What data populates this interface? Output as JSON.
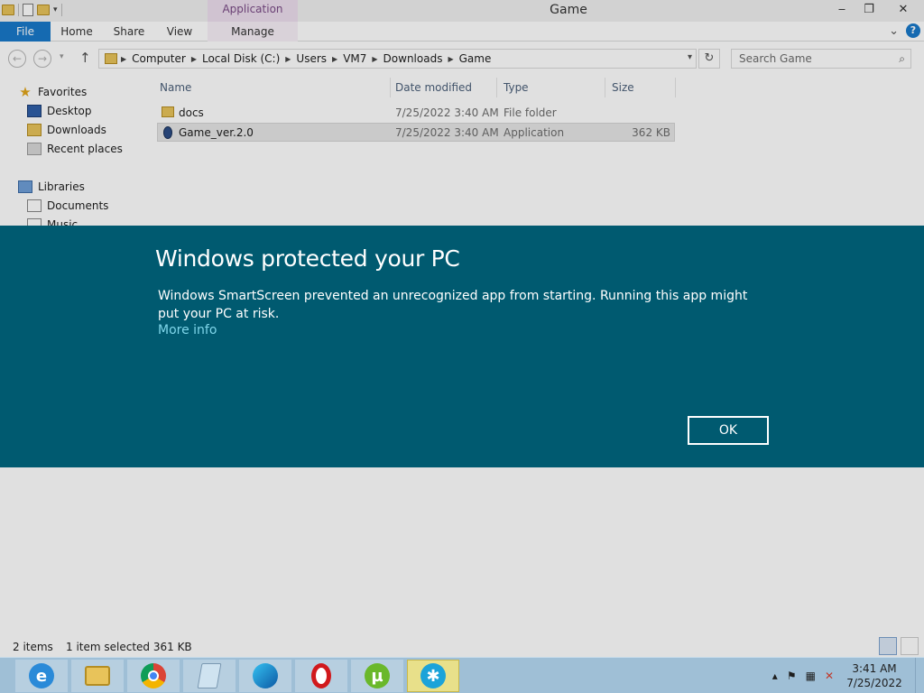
{
  "window": {
    "title": "Game",
    "contextual_tab_group": "Application Tools",
    "controls": {
      "minimize": "‒",
      "restore": "❐",
      "close": "✕"
    }
  },
  "ribbon": {
    "tabs": [
      {
        "label": "File"
      },
      {
        "label": "Home"
      },
      {
        "label": "Share"
      },
      {
        "label": "View"
      },
      {
        "label": "Manage"
      }
    ],
    "expand_glyph": "⌄",
    "help_glyph": "?"
  },
  "address": {
    "breadcrumbs": [
      "Computer",
      "Local Disk (C:)",
      "Users",
      "VM7",
      "Downloads",
      "Game"
    ],
    "search_placeholder": "Search Game"
  },
  "nav_glyphs": {
    "back": "←",
    "forward": "→",
    "up": "↑",
    "refresh": "↻",
    "dropdown": "▾",
    "sep": "▶",
    "search": "⌕"
  },
  "navigation_pane": {
    "favorites": {
      "label": "Favorites",
      "items": [
        "Desktop",
        "Downloads",
        "Recent places"
      ]
    },
    "libraries": {
      "label": "Libraries",
      "items": [
        "Documents",
        "Music"
      ]
    }
  },
  "file_list": {
    "columns": [
      "Name",
      "Date modified",
      "Type",
      "Size"
    ],
    "rows": [
      {
        "name": "docs",
        "date": "7/25/2022 3:40 AM",
        "type": "File folder",
        "size": ""
      },
      {
        "name": "Game_ver.2.0",
        "date": "7/25/2022 3:40 AM",
        "type": "Application",
        "size": "362 KB"
      }
    ]
  },
  "status_bar": {
    "items_count": "2 items",
    "selection": "1 item selected  361 KB"
  },
  "smartscreen": {
    "title": "Windows protected your PC",
    "message": "Windows SmartScreen prevented an unrecognized app from starting. Running this app might put your PC at risk.",
    "more_info": "More info",
    "ok_label": "OK",
    "background_color": "#005a70",
    "link_color": "#7fd6ea"
  },
  "taskbar": {
    "apps": [
      {
        "icon": "internet-explorer-icon",
        "glyph": "e"
      },
      {
        "icon": "file-explorer-icon",
        "glyph": ""
      },
      {
        "icon": "chrome-icon",
        "glyph": ""
      },
      {
        "icon": "notepad-icon",
        "glyph": ""
      },
      {
        "icon": "edge-icon",
        "glyph": ""
      },
      {
        "icon": "opera-icon",
        "glyph": ""
      },
      {
        "icon": "utorrent-icon",
        "glyph": "µ"
      },
      {
        "icon": "accessibility-app-icon",
        "glyph": "✱"
      }
    ],
    "tray_glyphs": {
      "chevron": "▴",
      "flag": "⚑",
      "network": "▦",
      "volume": "✕"
    },
    "clock_time": "3:41 AM",
    "clock_date": "7/25/2022"
  }
}
